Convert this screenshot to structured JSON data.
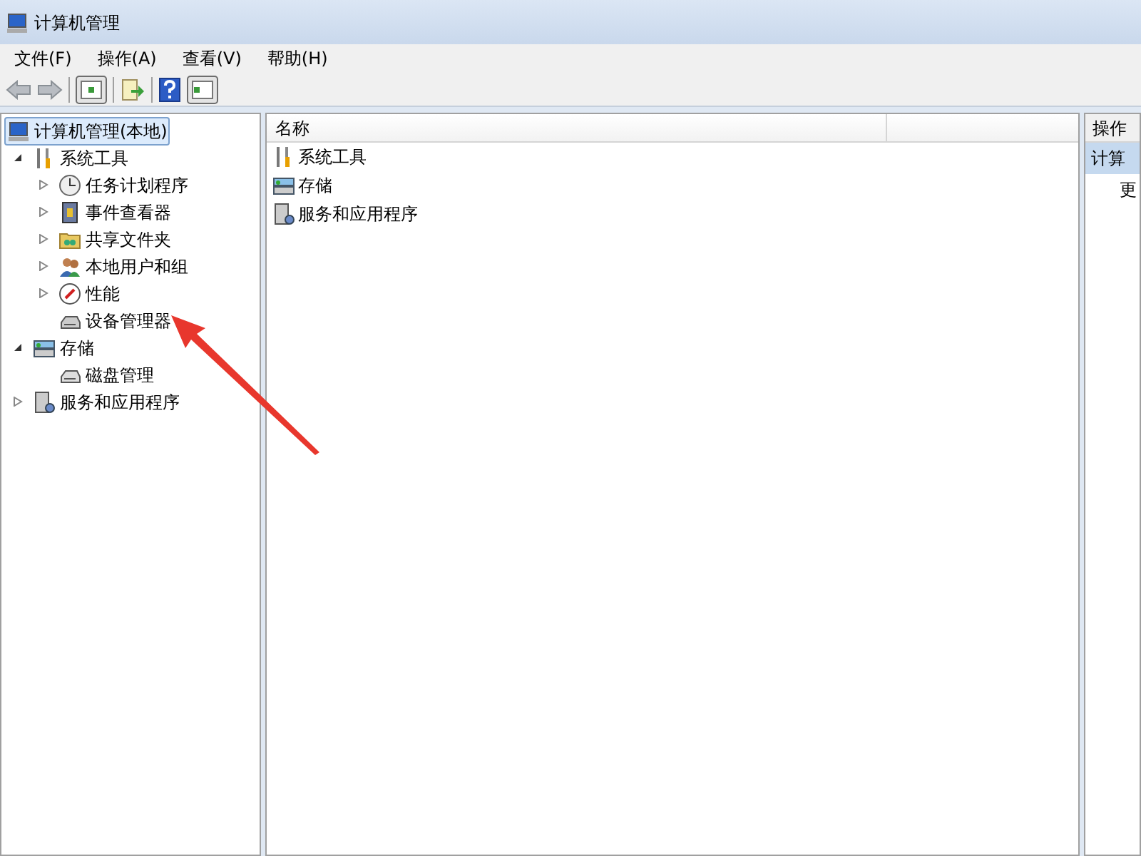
{
  "window": {
    "title": "计算机管理"
  },
  "menu": [
    "文件(F)",
    "操作(A)",
    "查看(V)",
    "帮助(H)"
  ],
  "tree": [
    {
      "label": "计算机管理(本地)",
      "kind": "computer",
      "selected": true,
      "children": [
        {
          "label": "系统工具",
          "kind": "tools",
          "selected": false,
          "expanded": true,
          "children": [
            {
              "label": "任务计划程序",
              "kind": "clock",
              "selected": false,
              "expanded": false
            },
            {
              "label": "事件查看器",
              "kind": "book",
              "selected": false,
              "expanded": false
            },
            {
              "label": "共享文件夹",
              "kind": "folder",
              "selected": false,
              "expanded": false
            },
            {
              "label": "本地用户和组",
              "kind": "users",
              "selected": false,
              "expanded": false
            },
            {
              "label": "性能",
              "kind": "gauge",
              "selected": false,
              "expanded": false
            },
            {
              "label": "设备管理器",
              "kind": "device",
              "selected": false
            }
          ]
        },
        {
          "label": "存储",
          "kind": "storage",
          "selected": false,
          "expanded": true,
          "children": [
            {
              "label": "磁盘管理",
              "kind": "disk",
              "selected": false
            }
          ]
        },
        {
          "label": "服务和应用程序",
          "kind": "server",
          "selected": false,
          "expanded": false
        }
      ]
    }
  ],
  "list": {
    "columns": [
      "名称"
    ],
    "rows": [
      {
        "label": "系统工具",
        "kind": "tools"
      },
      {
        "label": "存储",
        "kind": "storage"
      },
      {
        "label": "服务和应用程序",
        "kind": "server"
      }
    ]
  },
  "actions": {
    "header": "操作",
    "items": [
      {
        "label": "计算",
        "selected": true
      },
      {
        "label": "更",
        "selected": false
      }
    ]
  }
}
